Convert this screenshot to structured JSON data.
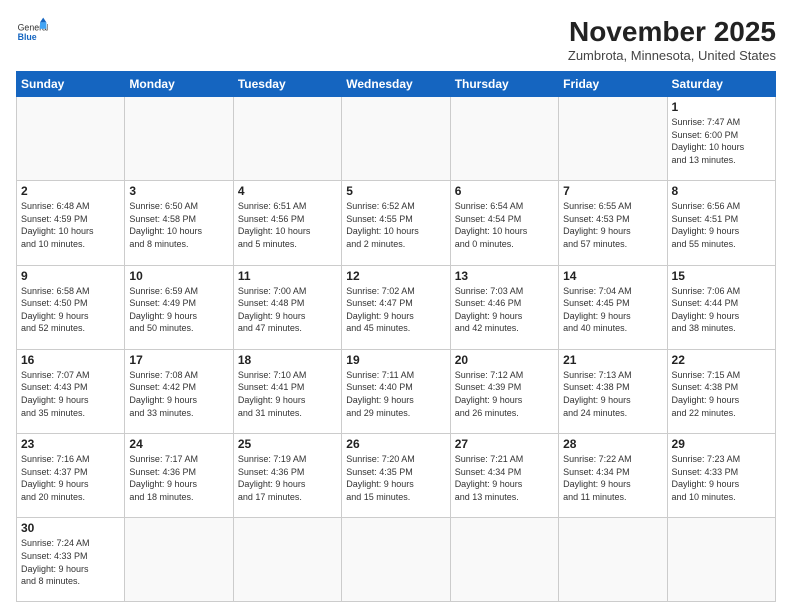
{
  "header": {
    "logo_general": "General",
    "logo_blue": "Blue",
    "month": "November 2025",
    "location": "Zumbrota, Minnesota, United States"
  },
  "weekdays": [
    "Sunday",
    "Monday",
    "Tuesday",
    "Wednesday",
    "Thursday",
    "Friday",
    "Saturday"
  ],
  "weeks": [
    [
      {
        "day": "",
        "info": ""
      },
      {
        "day": "",
        "info": ""
      },
      {
        "day": "",
        "info": ""
      },
      {
        "day": "",
        "info": ""
      },
      {
        "day": "",
        "info": ""
      },
      {
        "day": "",
        "info": ""
      },
      {
        "day": "1",
        "info": "Sunrise: 7:47 AM\nSunset: 6:00 PM\nDaylight: 10 hours\nand 13 minutes."
      }
    ],
    [
      {
        "day": "2",
        "info": "Sunrise: 6:48 AM\nSunset: 4:59 PM\nDaylight: 10 hours\nand 10 minutes."
      },
      {
        "day": "3",
        "info": "Sunrise: 6:50 AM\nSunset: 4:58 PM\nDaylight: 10 hours\nand 8 minutes."
      },
      {
        "day": "4",
        "info": "Sunrise: 6:51 AM\nSunset: 4:56 PM\nDaylight: 10 hours\nand 5 minutes."
      },
      {
        "day": "5",
        "info": "Sunrise: 6:52 AM\nSunset: 4:55 PM\nDaylight: 10 hours\nand 2 minutes."
      },
      {
        "day": "6",
        "info": "Sunrise: 6:54 AM\nSunset: 4:54 PM\nDaylight: 10 hours\nand 0 minutes."
      },
      {
        "day": "7",
        "info": "Sunrise: 6:55 AM\nSunset: 4:53 PM\nDaylight: 9 hours\nand 57 minutes."
      },
      {
        "day": "8",
        "info": "Sunrise: 6:56 AM\nSunset: 4:51 PM\nDaylight: 9 hours\nand 55 minutes."
      }
    ],
    [
      {
        "day": "9",
        "info": "Sunrise: 6:58 AM\nSunset: 4:50 PM\nDaylight: 9 hours\nand 52 minutes."
      },
      {
        "day": "10",
        "info": "Sunrise: 6:59 AM\nSunset: 4:49 PM\nDaylight: 9 hours\nand 50 minutes."
      },
      {
        "day": "11",
        "info": "Sunrise: 7:00 AM\nSunset: 4:48 PM\nDaylight: 9 hours\nand 47 minutes."
      },
      {
        "day": "12",
        "info": "Sunrise: 7:02 AM\nSunset: 4:47 PM\nDaylight: 9 hours\nand 45 minutes."
      },
      {
        "day": "13",
        "info": "Sunrise: 7:03 AM\nSunset: 4:46 PM\nDaylight: 9 hours\nand 42 minutes."
      },
      {
        "day": "14",
        "info": "Sunrise: 7:04 AM\nSunset: 4:45 PM\nDaylight: 9 hours\nand 40 minutes."
      },
      {
        "day": "15",
        "info": "Sunrise: 7:06 AM\nSunset: 4:44 PM\nDaylight: 9 hours\nand 38 minutes."
      }
    ],
    [
      {
        "day": "16",
        "info": "Sunrise: 7:07 AM\nSunset: 4:43 PM\nDaylight: 9 hours\nand 35 minutes."
      },
      {
        "day": "17",
        "info": "Sunrise: 7:08 AM\nSunset: 4:42 PM\nDaylight: 9 hours\nand 33 minutes."
      },
      {
        "day": "18",
        "info": "Sunrise: 7:10 AM\nSunset: 4:41 PM\nDaylight: 9 hours\nand 31 minutes."
      },
      {
        "day": "19",
        "info": "Sunrise: 7:11 AM\nSunset: 4:40 PM\nDaylight: 9 hours\nand 29 minutes."
      },
      {
        "day": "20",
        "info": "Sunrise: 7:12 AM\nSunset: 4:39 PM\nDaylight: 9 hours\nand 26 minutes."
      },
      {
        "day": "21",
        "info": "Sunrise: 7:13 AM\nSunset: 4:38 PM\nDaylight: 9 hours\nand 24 minutes."
      },
      {
        "day": "22",
        "info": "Sunrise: 7:15 AM\nSunset: 4:38 PM\nDaylight: 9 hours\nand 22 minutes."
      }
    ],
    [
      {
        "day": "23",
        "info": "Sunrise: 7:16 AM\nSunset: 4:37 PM\nDaylight: 9 hours\nand 20 minutes."
      },
      {
        "day": "24",
        "info": "Sunrise: 7:17 AM\nSunset: 4:36 PM\nDaylight: 9 hours\nand 18 minutes."
      },
      {
        "day": "25",
        "info": "Sunrise: 7:19 AM\nSunset: 4:36 PM\nDaylight: 9 hours\nand 17 minutes."
      },
      {
        "day": "26",
        "info": "Sunrise: 7:20 AM\nSunset: 4:35 PM\nDaylight: 9 hours\nand 15 minutes."
      },
      {
        "day": "27",
        "info": "Sunrise: 7:21 AM\nSunset: 4:34 PM\nDaylight: 9 hours\nand 13 minutes."
      },
      {
        "day": "28",
        "info": "Sunrise: 7:22 AM\nSunset: 4:34 PM\nDaylight: 9 hours\nand 11 minutes."
      },
      {
        "day": "29",
        "info": "Sunrise: 7:23 AM\nSunset: 4:33 PM\nDaylight: 9 hours\nand 10 minutes."
      }
    ],
    [
      {
        "day": "30",
        "info": "Sunrise: 7:24 AM\nSunset: 4:33 PM\nDaylight: 9 hours\nand 8 minutes."
      },
      {
        "day": "",
        "info": ""
      },
      {
        "day": "",
        "info": ""
      },
      {
        "day": "",
        "info": ""
      },
      {
        "day": "",
        "info": ""
      },
      {
        "day": "",
        "info": ""
      },
      {
        "day": "",
        "info": ""
      }
    ]
  ]
}
